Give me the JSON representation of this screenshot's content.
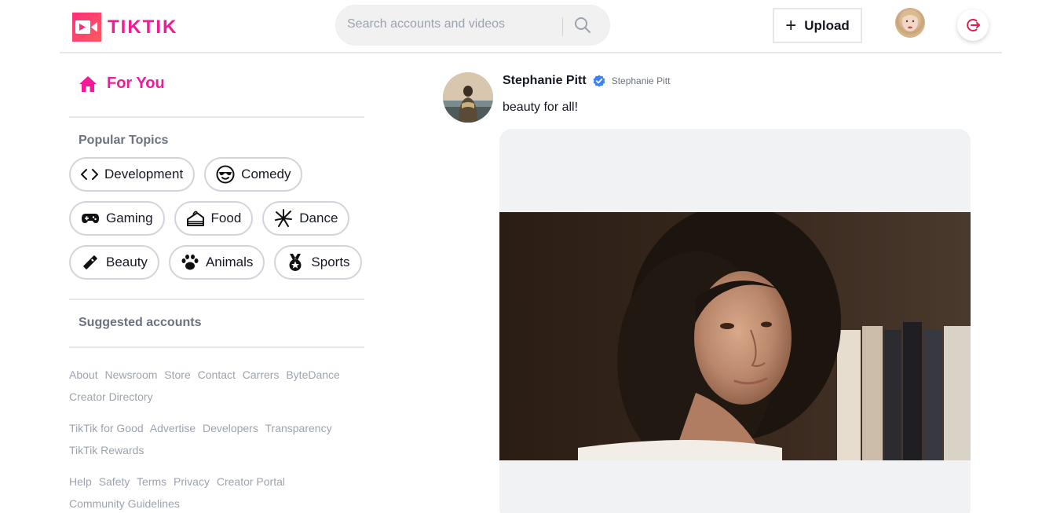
{
  "brand": {
    "name": "TIKTIK",
    "accent": "#f51997"
  },
  "search": {
    "placeholder": "Search accounts and videos",
    "value": ""
  },
  "header": {
    "upload_label": "Upload"
  },
  "sidebar": {
    "for_you_label": "For You",
    "popular_topics_title": "Popular Topics",
    "topics": [
      {
        "label": "Development",
        "icon": "code-icon"
      },
      {
        "label": "Comedy",
        "icon": "sunglasses-face-icon"
      },
      {
        "label": "Gaming",
        "icon": "gamepad-icon"
      },
      {
        "label": "Food",
        "icon": "cake-icon"
      },
      {
        "label": "Dance",
        "icon": "dancer-icon"
      },
      {
        "label": "Beauty",
        "icon": "lipstick-icon"
      },
      {
        "label": "Animals",
        "icon": "paw-icon"
      },
      {
        "label": "Sports",
        "icon": "medal-icon"
      }
    ],
    "suggested_title": "Suggested accounts",
    "footer": {
      "group1": [
        "About",
        "Newsroom",
        "Store",
        "Contact",
        "Carrers",
        "ByteDance",
        "Creator Directory"
      ],
      "group2": [
        "TikTik for Good",
        "Advertise",
        "Developers",
        "Transparency",
        "TikTik Rewards"
      ],
      "group3": [
        "Help",
        "Safety",
        "Terms",
        "Privacy",
        "Creator Portal",
        "Community Guidelines"
      ]
    }
  },
  "post": {
    "user_name": "Stephanie Pitt",
    "user_handle": "Stephanie Pitt",
    "verified": true,
    "caption": "beauty for all!"
  }
}
